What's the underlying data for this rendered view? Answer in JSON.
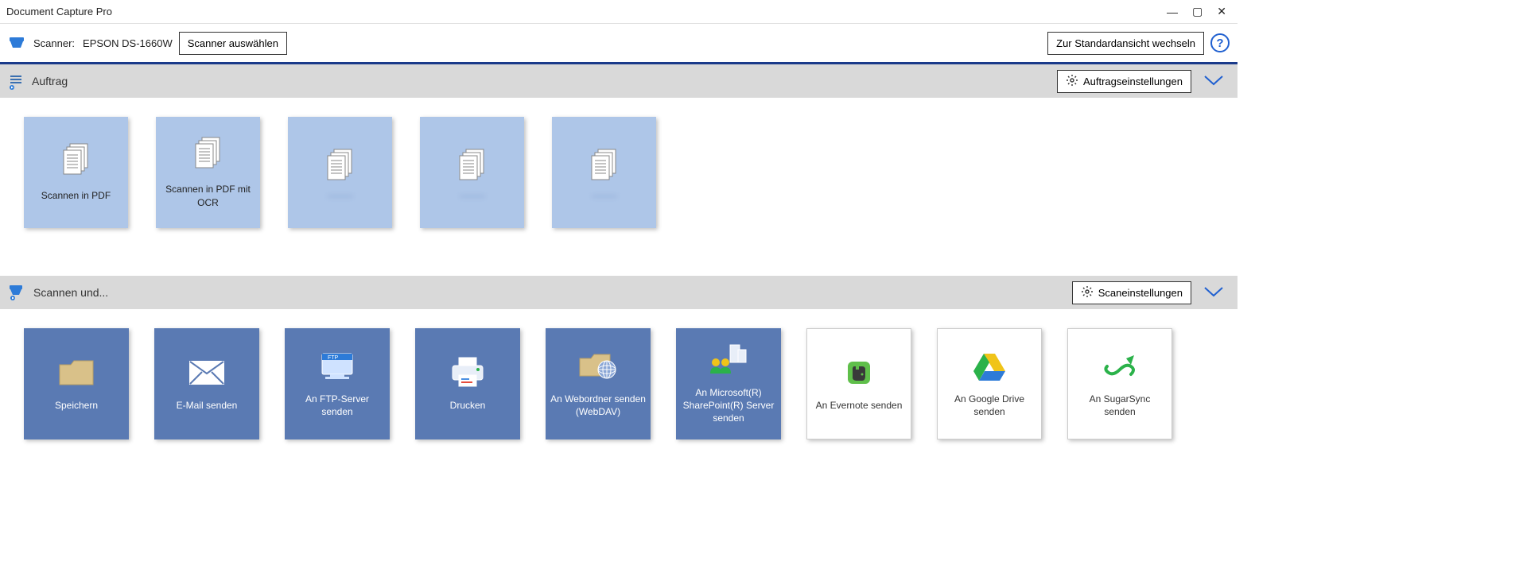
{
  "window": {
    "title": "Document Capture Pro"
  },
  "toolbar": {
    "scanner_label": "Scanner:",
    "scanner_name": "EPSON DS-1660W",
    "select_scanner": "Scanner auswählen",
    "switch_view": "Zur Standardansicht wechseln"
  },
  "sections": {
    "jobs": {
      "title": "Auftrag",
      "settings": "Auftragseinstellungen"
    },
    "scan": {
      "title": "Scannen und...",
      "settings": "Scaneinstellungen"
    }
  },
  "jobs": [
    {
      "label": "Scannen in PDF"
    },
    {
      "label": "Scannen in PDF mit OCR"
    },
    {
      "label": ""
    },
    {
      "label": ""
    },
    {
      "label": ""
    }
  ],
  "destinations": [
    {
      "label": "Speichern",
      "style": "blue",
      "icon": "folder"
    },
    {
      "label": "E-Mail senden",
      "style": "blue",
      "icon": "mail"
    },
    {
      "label": "An FTP-Server senden",
      "style": "blue",
      "icon": "ftp"
    },
    {
      "label": "Drucken",
      "style": "blue",
      "icon": "printer"
    },
    {
      "label": "An Webordner senden (WebDAV)",
      "style": "blue",
      "icon": "webdav"
    },
    {
      "label": "An Microsoft(R) SharePoint(R) Server senden",
      "style": "blue",
      "icon": "sharepoint"
    },
    {
      "label": "An Evernote senden",
      "style": "white",
      "icon": "evernote"
    },
    {
      "label": "An Google Drive senden",
      "style": "white",
      "icon": "gdrive"
    },
    {
      "label": "An SugarSync senden",
      "style": "white",
      "icon": "sugarsync"
    }
  ]
}
